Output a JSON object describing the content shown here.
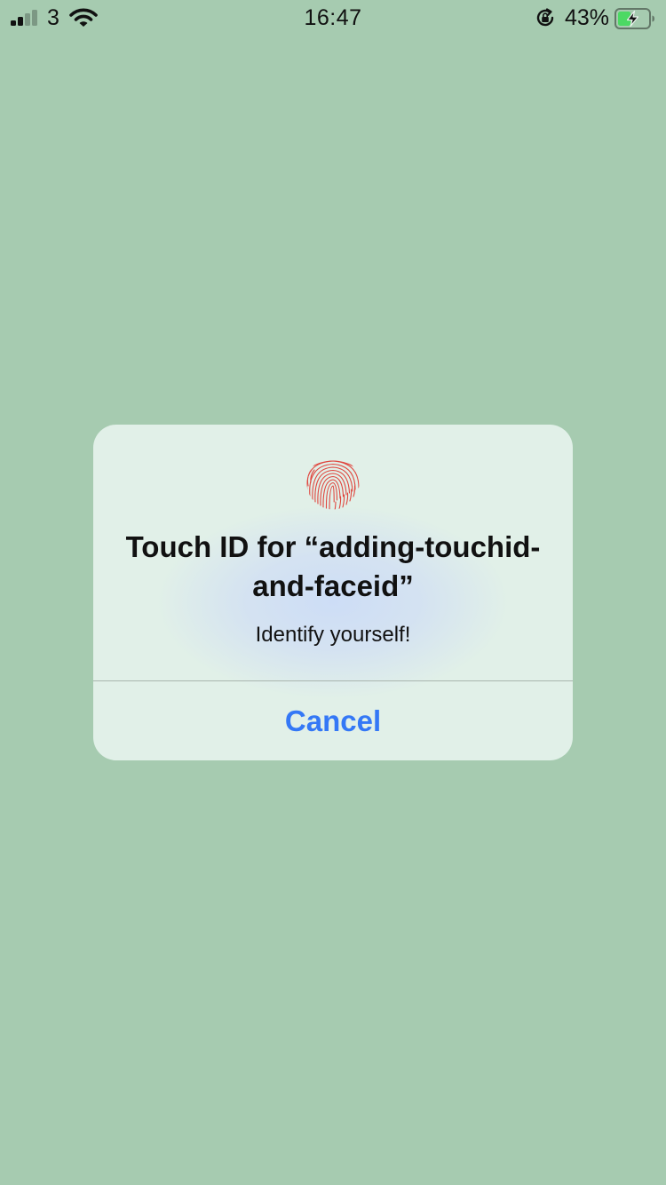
{
  "status_bar": {
    "carrier": "3",
    "time": "16:47",
    "battery_percent": "43%",
    "signal_bars_filled": 2,
    "signal_bars_total": 4,
    "battery_level": 0.43,
    "battery_charging": true
  },
  "alert": {
    "icon": "fingerprint-icon",
    "title": "Touch ID for “adding-touchid-\nand-faceid”",
    "message": "Identify yourself!",
    "cancel_label": "Cancel"
  },
  "colors": {
    "background": "#a6cbb0",
    "alert_background": "#e1f0e8",
    "button_blue": "#3478f6",
    "fingerprint_red": "#e0463f",
    "battery_green": "#4cd964"
  }
}
